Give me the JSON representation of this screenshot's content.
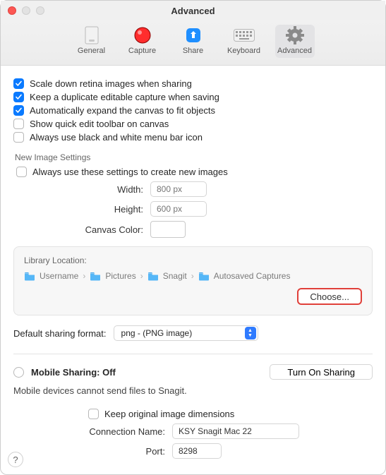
{
  "window": {
    "title": "Advanced"
  },
  "toolbar": {
    "general": "General",
    "capture": "Capture",
    "share": "Share",
    "keyboard": "Keyboard",
    "advanced": "Advanced"
  },
  "checks": {
    "scale": "Scale down retina images when sharing",
    "dup": "Keep a duplicate editable capture when saving",
    "expand": "Automatically expand the canvas to fit objects",
    "quick": "Show quick edit toolbar on canvas",
    "bw": "Always use black and white menu bar icon"
  },
  "newimg": {
    "section": "New Image Settings",
    "always": "Always use these settings to create new images",
    "width_label": "Width:",
    "height_label": "Height:",
    "canvas_label": "Canvas Color:",
    "width_ph": "800 px",
    "height_ph": "600 px"
  },
  "library": {
    "title": "Library Location:",
    "segs": [
      "Username",
      "Pictures",
      "Snagit",
      "Autosaved Captures"
    ],
    "choose": "Choose..."
  },
  "sharefmt": {
    "label": "Default sharing format:",
    "value": "png - (PNG image)"
  },
  "mobile": {
    "title": "Mobile Sharing: Off",
    "btn": "Turn On Sharing",
    "desc": "Mobile devices cannot send files to Snagit.",
    "keep": "Keep original image dimensions",
    "conn_label": "Connection Name:",
    "conn_value": "KSY Snagit Mac 22",
    "port_label": "Port:",
    "port_value": "8298"
  },
  "help": "?"
}
